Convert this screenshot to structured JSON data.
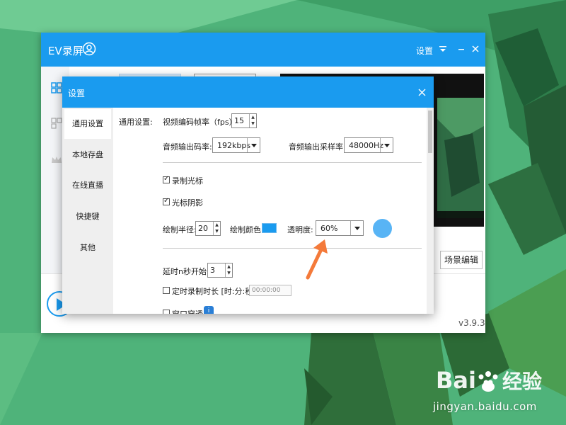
{
  "main_window": {
    "title": "EV录屏",
    "settings_link": "设置",
    "scene_edit_button": "场景编辑",
    "version": "v3.9.3"
  },
  "dialog": {
    "title": "设置",
    "nav": [
      {
        "label": "通用设置",
        "active": true
      },
      {
        "label": "本地存盘",
        "active": false
      },
      {
        "label": "在线直播",
        "active": false
      },
      {
        "label": "快捷键",
        "active": false
      },
      {
        "label": "其他",
        "active": false
      }
    ],
    "general": {
      "section_label": "通用设置:",
      "fps_label": "视频编码帧率（fps）:",
      "fps_value": "15",
      "bitrate_label": "音频输出码率:",
      "bitrate_value": "192kbps",
      "samplerate_label": "音频输出采样率:",
      "samplerate_value": "48000Hz",
      "record_cursor_label": "录制光标",
      "record_cursor_checked": true,
      "cursor_shadow_label": "光标阴影",
      "cursor_shadow_checked": true,
      "radius_label": "绘制半径:",
      "radius_value": "20",
      "color_label": "绘制颜色:",
      "draw_color": "#1a9bef",
      "opacity_label": "透明度:",
      "opacity_value": "60%",
      "delay_label": "延时n秒开始:",
      "delay_value": "3",
      "timed_label": "定时录制时长 [时:分:秒]:",
      "timed_checked": false,
      "timed_value": "00:00:00",
      "window_through_label": "窗口穿透",
      "window_through_checked": false
    }
  },
  "watermark": {
    "logo_text": "Bai经验",
    "url": "jingyan.baidu.com"
  },
  "colors": {
    "accent": "#1a9bef",
    "annotation_arrow": "#f47a3a"
  }
}
